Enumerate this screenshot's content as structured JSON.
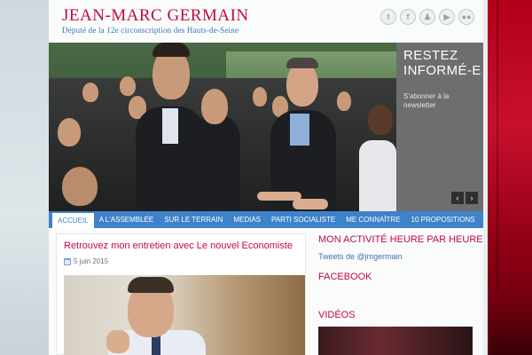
{
  "header": {
    "title": "JEAN-MARC GERMAIN",
    "subtitle": "Député de la 12e circonscription des Hauts-de-Seine",
    "social_icons": [
      {
        "name": "twitter-icon",
        "glyph": "t"
      },
      {
        "name": "facebook-icon",
        "glyph": "f"
      },
      {
        "name": "people-icon",
        "glyph": "♟"
      },
      {
        "name": "youtube-icon",
        "glyph": "▶"
      },
      {
        "name": "flickr-icon",
        "glyph": "●●"
      }
    ]
  },
  "slider": {
    "headline": "RESTEZ INFORMÉ-E",
    "subtext": "S'abonner à la newsletter",
    "prev": "‹",
    "next": "›"
  },
  "nav": {
    "items": [
      "ACCUEIL",
      "A L'ASSEMBLÉE",
      "SUR LE TERRAIN",
      "MEDIAS",
      "PARTI SOCIALISTE",
      "ME CONNAÎTRE",
      "10 PROPOSITIONS"
    ]
  },
  "post": {
    "title": "Retrouvez mon entretien avec Le nouvel Economiste",
    "date": "5 juin 2015"
  },
  "sidebar": {
    "activity_heading": "MON ACTIVITÉ HEURE PAR HEURE",
    "tweets_link": "Tweets de @jmgermain",
    "facebook_heading": "FACEBOOK",
    "videos_heading": "VIDÉOS"
  },
  "colors": {
    "accent_red": "#c20b3a",
    "nav_blue": "#3e82c9",
    "link_blue": "#3c74b4"
  }
}
